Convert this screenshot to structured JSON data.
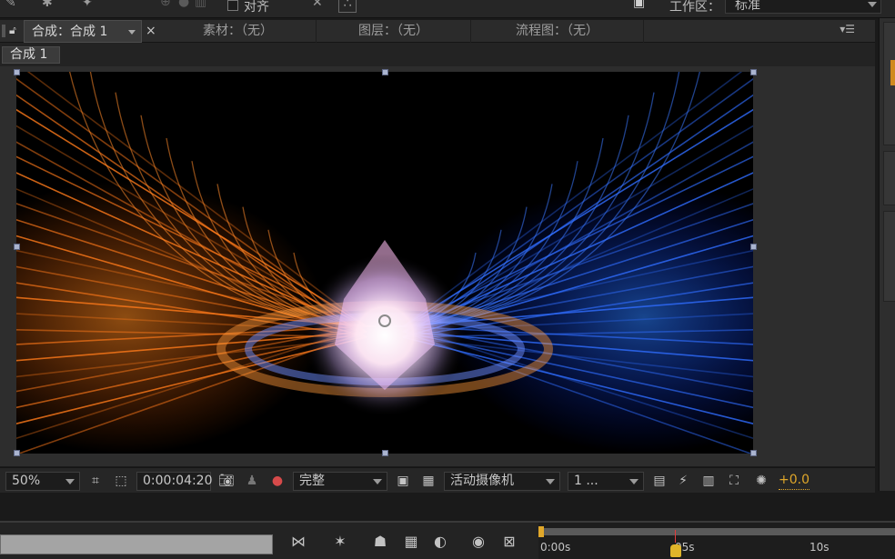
{
  "toolbar": {
    "snap_label": "对齐",
    "snap_checked": false,
    "workspace_label": "工作区：",
    "workspace_value": "标准"
  },
  "panel_tabs": {
    "composition_tab": "合成：合成 1",
    "footage_tab": "素材：（无）",
    "layer_tab": "图层：（无）",
    "flowchart_tab": "流程图：（无）"
  },
  "comp_subtab": "合成 1",
  "viewer_controls": {
    "magnification": "50%",
    "timecode": "0:00:04:20",
    "resolution": "完整",
    "camera_view": "活动摄像机",
    "view_layout": "1 ...",
    "exposure": "+0.0"
  },
  "timeline": {
    "ruler_labels": [
      "0:00s",
      "05s",
      "10s"
    ]
  },
  "colors": {
    "accent_orange": "#e0a72a",
    "warm_light": "#ff7a1a",
    "cool_light": "#2f6dff",
    "background": "#1a1a1a"
  },
  "icons": {
    "zoom_icon": "viewer-zoom",
    "snapshot": "camera-icon"
  }
}
